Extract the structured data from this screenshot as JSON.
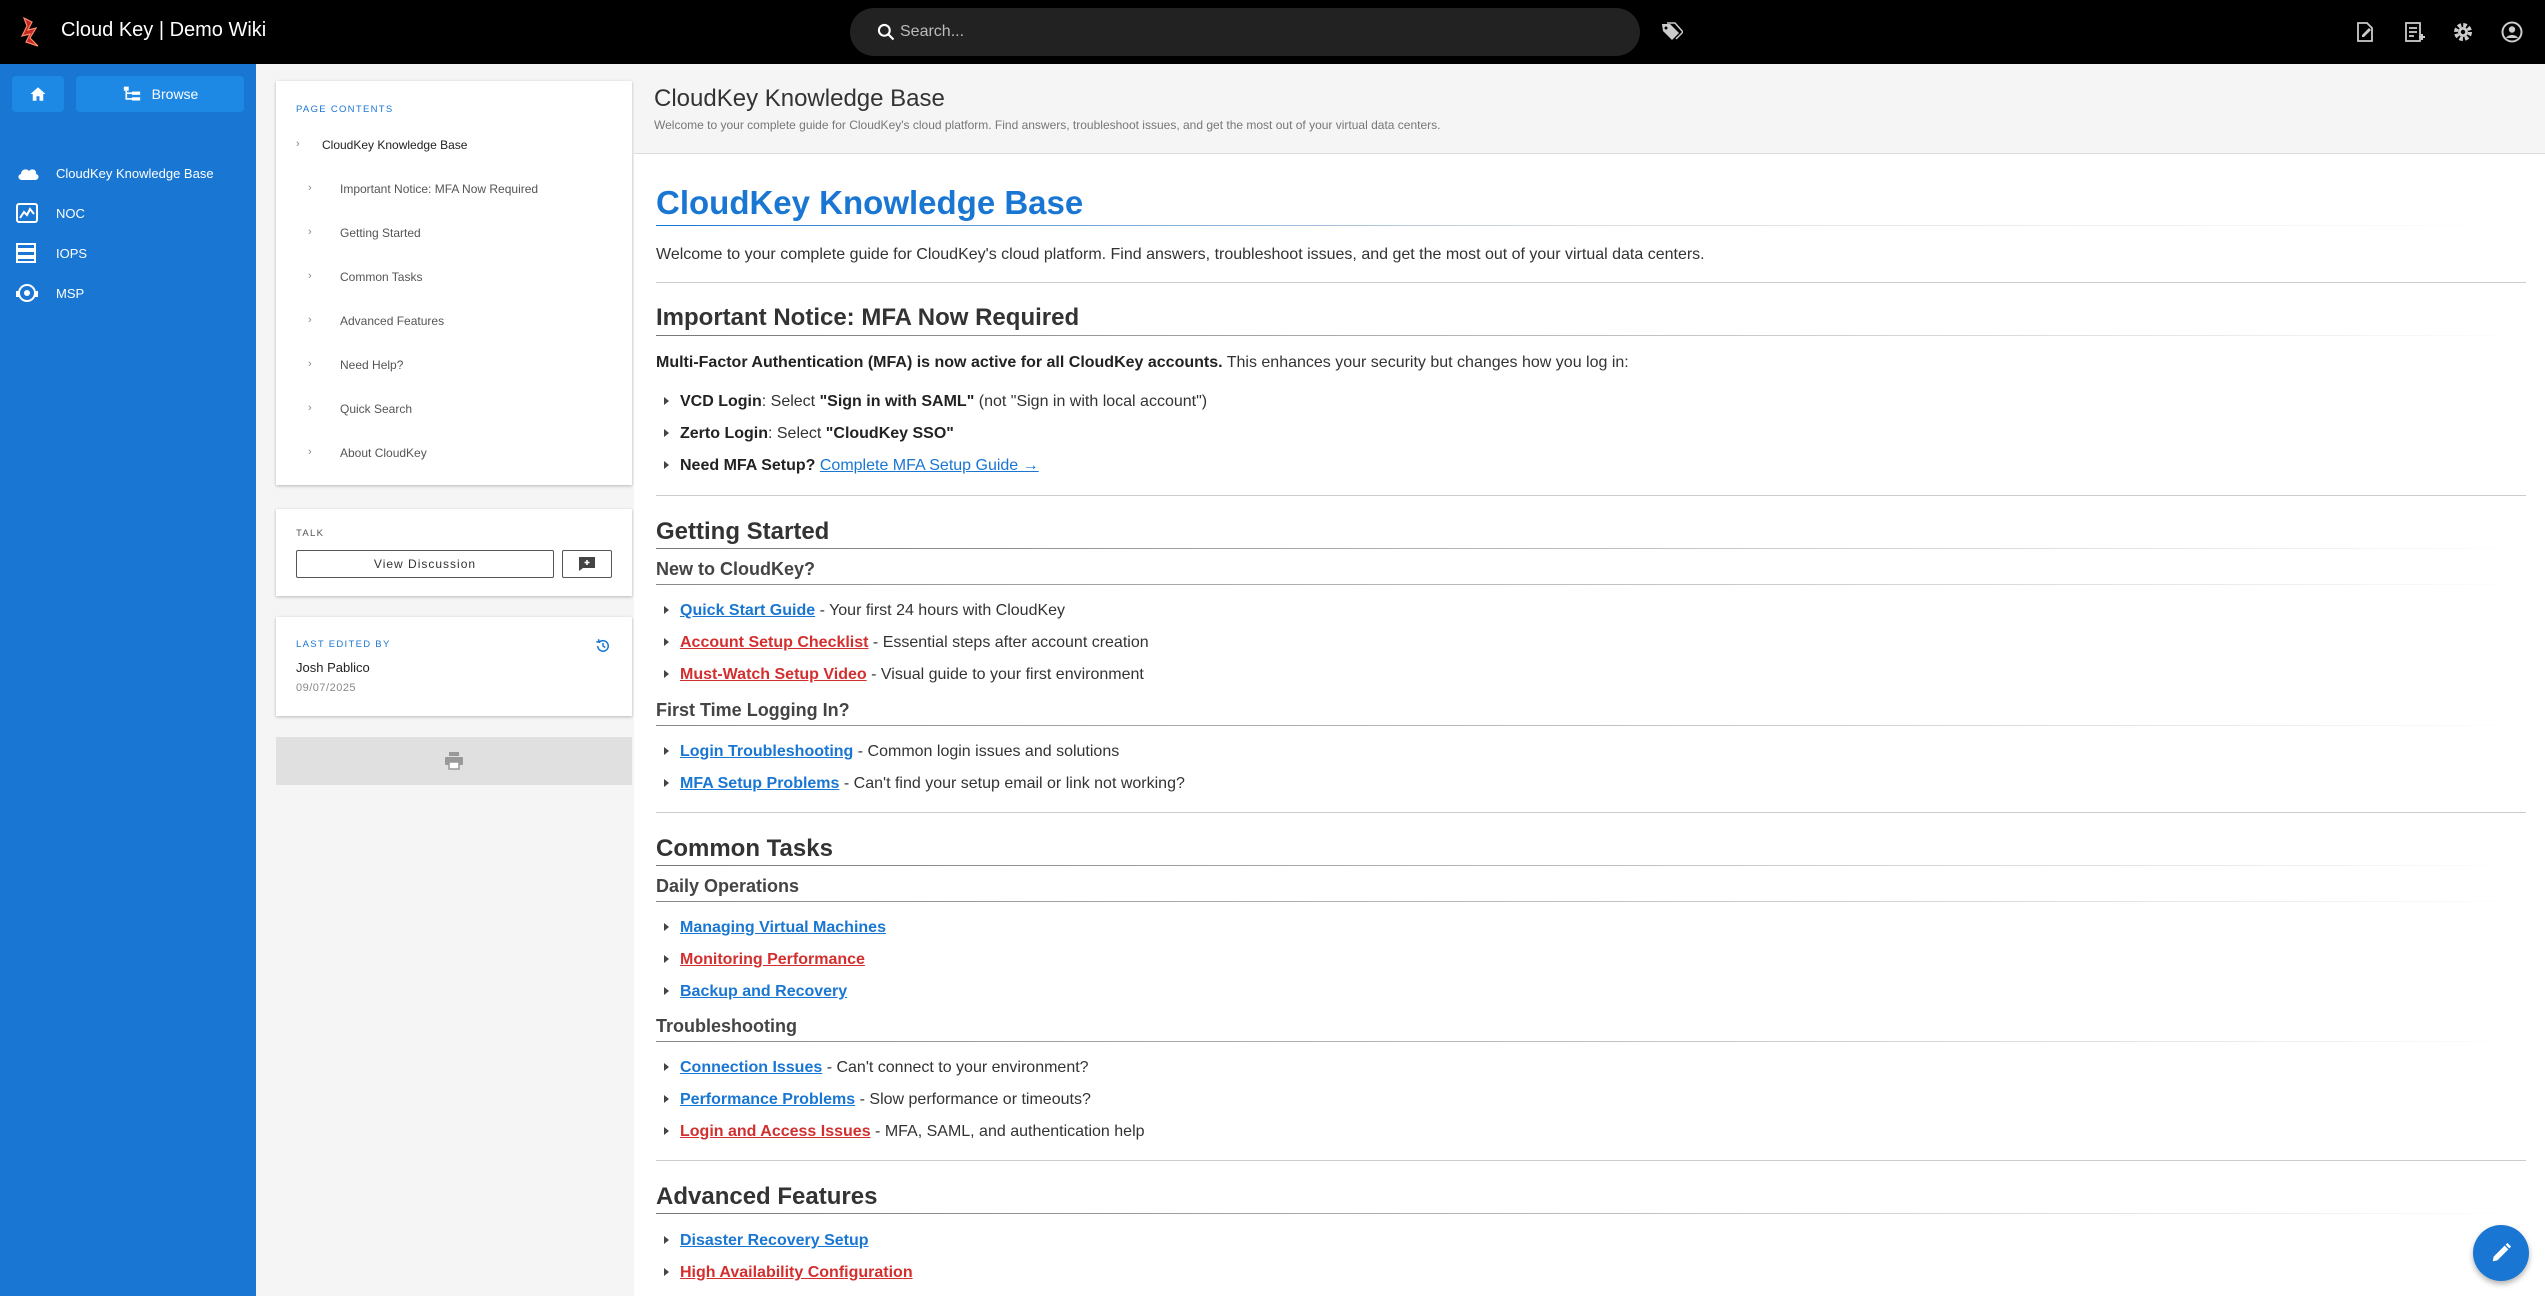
{
  "app": {
    "title": "Cloud Key | Demo Wiki"
  },
  "search": {
    "placeholder": "Search..."
  },
  "topbar_icons": [
    "tag-icon",
    "new-page-icon",
    "page-actions-icon",
    "settings-icon",
    "account-icon"
  ],
  "leftnav": {
    "browse_label": "Browse",
    "items": [
      {
        "label": "CloudKey Knowledge Base",
        "icon": "cloud-icon"
      },
      {
        "label": "NOC",
        "icon": "monitor-chart-icon"
      },
      {
        "label": "IOPS",
        "icon": "server-icon"
      },
      {
        "label": "MSP",
        "icon": "support-icon"
      }
    ]
  },
  "toc": {
    "heading": "Page Contents",
    "root": "CloudKey Knowledge Base",
    "items": [
      "Important Notice: MFA Now Required",
      "Getting Started",
      "Common Tasks",
      "Advanced Features",
      "Need Help?",
      "Quick Search",
      "About CloudKey"
    ]
  },
  "talk": {
    "heading": "Talk",
    "view_label": "View Discussion"
  },
  "last_edited": {
    "heading": "Last edited by",
    "name": "Josh Pablico",
    "date": "09/07/2025"
  },
  "page_header": {
    "title": "CloudKey Knowledge Base",
    "subtitle": "Welcome to your complete guide for CloudKey's cloud platform. Find answers, troubleshoot issues, and get the most out of your virtual data centers."
  },
  "content": {
    "h1": "CloudKey Knowledge Base",
    "intro": "Welcome to your complete guide for CloudKey's cloud platform. Find answers, troubleshoot issues, and get the most out of your virtual data centers.",
    "mfa": {
      "heading": "Important Notice: MFA Now Required",
      "lead_bold": "Multi-Factor Authentication (MFA) is now active for all CloudKey accounts.",
      "lead_rest": " This enhances your security but changes how you log in:",
      "vcd_label": "VCD Login",
      "vcd_mid": ": Select ",
      "vcd_bold": "\"Sign in with SAML\"",
      "vcd_rest": " (not \"Sign in with local account\")",
      "zerto_label": "Zerto Login",
      "zerto_mid": ": Select ",
      "zerto_bold": "\"CloudKey SSO\"",
      "need_label": "Need MFA Setup?",
      "need_link": "Complete MFA Setup Guide →"
    },
    "getting_started": {
      "heading": "Getting Started",
      "new_heading": "New to CloudKey?",
      "new_items": [
        {
          "link": "Quick Start Guide",
          "desc": " - Your first 24 hours with CloudKey"
        },
        {
          "link": "Account Setup Checklist",
          "desc": " - Essential steps after account creation"
        },
        {
          "link": "Must-Watch Setup Video",
          "desc": " - Visual guide to your first environment"
        }
      ],
      "first_heading": "First Time Logging In?",
      "first_items": [
        {
          "link": "Login Troubleshooting",
          "desc": " - Common login issues and solutions"
        },
        {
          "link": "MFA Setup Problems",
          "desc": " - Can't find your setup email or link not working?"
        }
      ]
    },
    "common_tasks": {
      "heading": "Common Tasks",
      "daily_heading": "Daily Operations",
      "daily_items": [
        {
          "link": "Managing Virtual Machines"
        },
        {
          "link": "Monitoring Performance"
        },
        {
          "link": "Backup and Recovery"
        }
      ],
      "trouble_heading": "Troubleshooting",
      "trouble_items": [
        {
          "link": "Connection Issues",
          "desc": " - Can't connect to your environment?"
        },
        {
          "link": "Performance Problems",
          "desc": " - Slow performance or timeouts?"
        },
        {
          "link": "Login and Access Issues",
          "desc": " - MFA, SAML, and authentication help"
        }
      ]
    },
    "advanced": {
      "heading": "Advanced Features",
      "items": [
        {
          "link": "Disaster Recovery Setup"
        },
        {
          "link": "High Availability Configuration"
        }
      ]
    }
  },
  "colors": {
    "primary": "#1976d2",
    "link_missing": "#d32f2f",
    "topbar": "#000000"
  }
}
